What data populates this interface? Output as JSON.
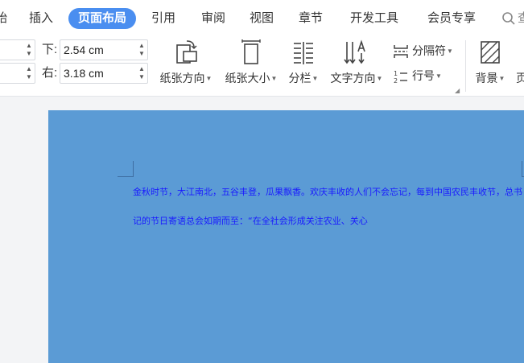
{
  "menu": {
    "partial_left": "始",
    "tabs": [
      "插入",
      "页面布局",
      "引用",
      "审阅",
      "视图",
      "章节",
      "开发工具",
      "会员专享"
    ],
    "active_tab": "页面布局",
    "search_partial": "查"
  },
  "margins": {
    "top_value_partial": "",
    "left_value_partial": "",
    "bottom_label": "下:",
    "bottom_value": "2.54 cm",
    "right_label": "右:",
    "right_value": "3.18 cm"
  },
  "ribbon": {
    "orientation": "纸张方向",
    "size": "纸张大小",
    "columns": "分栏",
    "text_direction": "文字方向",
    "separator": "分隔符",
    "line_numbers": "行号",
    "background": "背景",
    "page_border_partial": "页"
  },
  "document": {
    "line1": "金秋时节，大江南北，五谷丰登，瓜果飘香。欢庆丰收的人们不会忘记，每到中国农民丰收节，总书",
    "line2": "记的节日寄语总会如期而至：“在全社会形成关注农业、关心"
  },
  "colors": {
    "accent": "#4a8ef0",
    "page_background": "#5b9bd5",
    "body_text": "#1a1aff"
  }
}
